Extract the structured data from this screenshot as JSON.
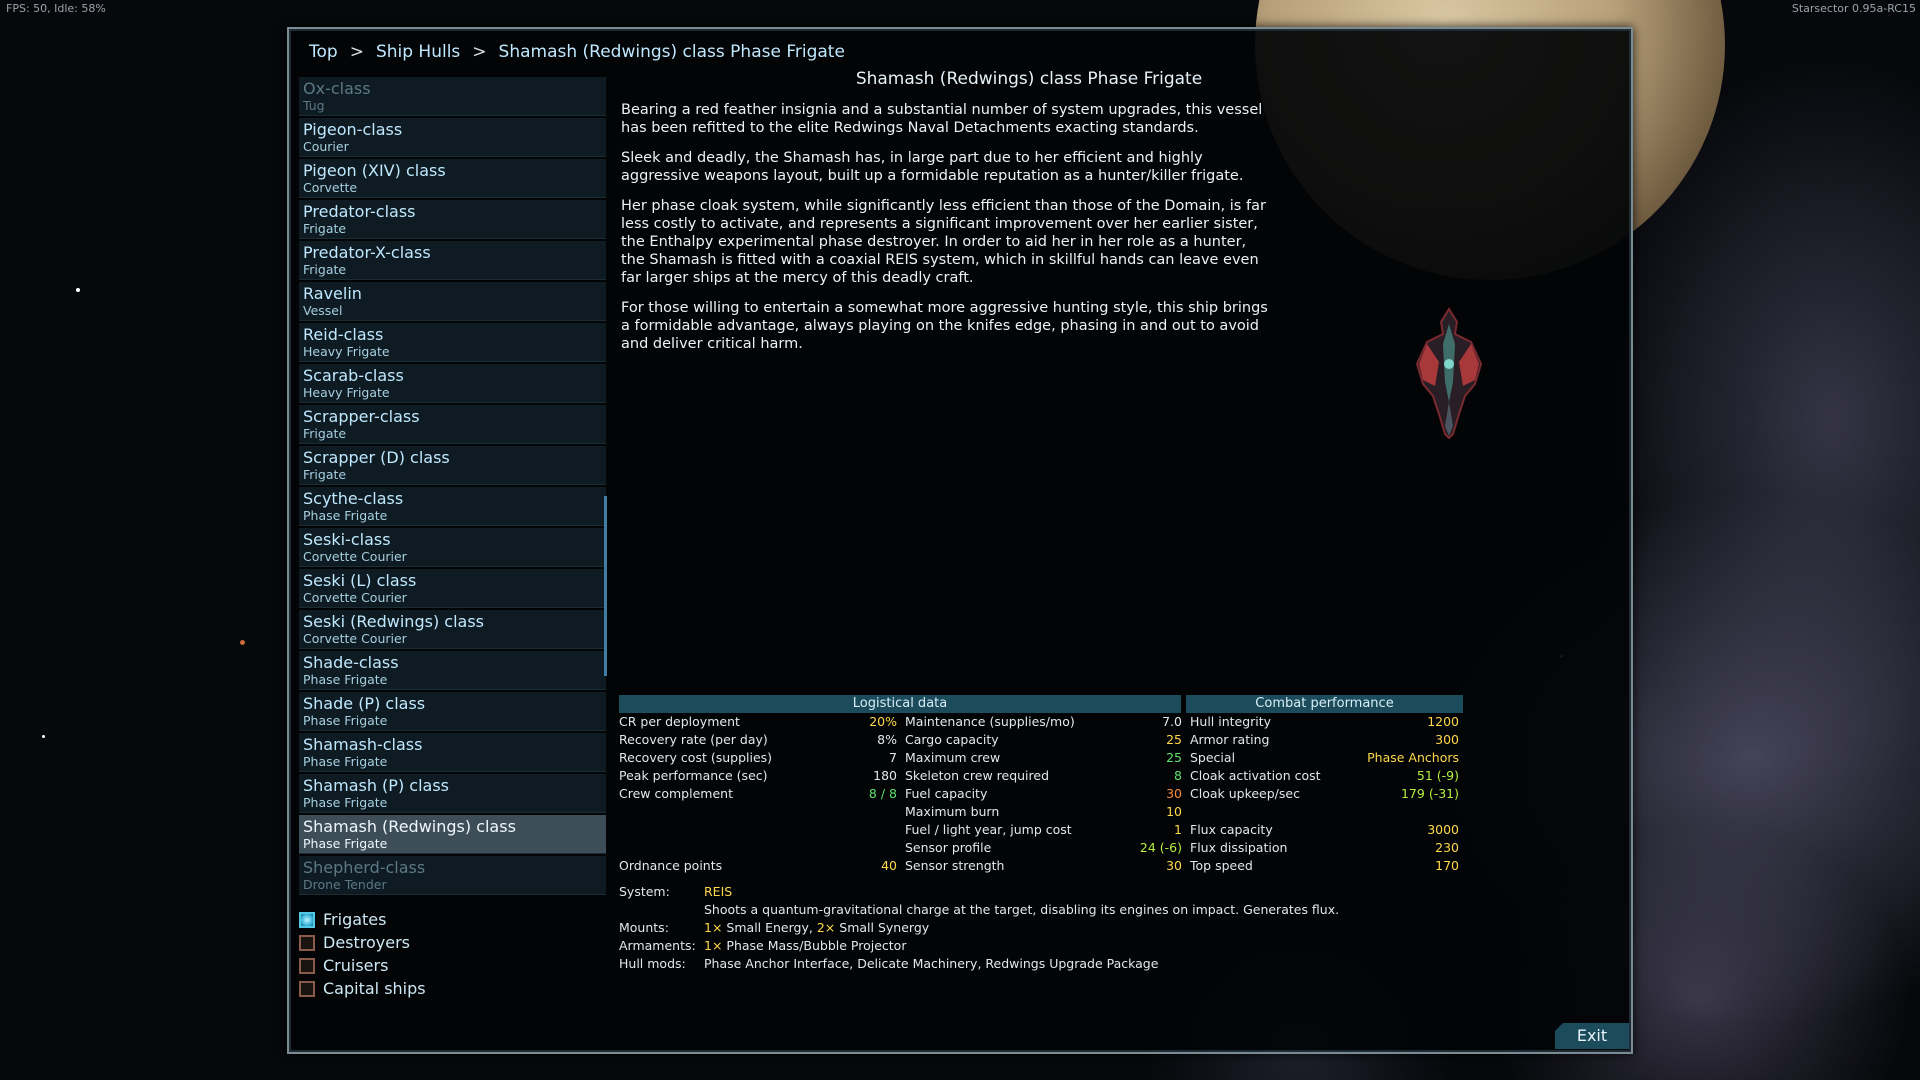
{
  "hud": {
    "fps": "FPS: 50, Idle: 58%",
    "version": "Starsector 0.95a-RC15"
  },
  "breadcrumb": {
    "root": "Top",
    "sep1": ">",
    "section": "Ship Hulls",
    "sep2": ">",
    "current": "Shamash (Redwings) class Phase Frigate"
  },
  "ships": [
    {
      "name": "Ox-class",
      "role": "Tug"
    },
    {
      "name": "Pigeon-class",
      "role": "Courier"
    },
    {
      "name": "Pigeon (XIV) class",
      "role": "Corvette"
    },
    {
      "name": "Predator-class",
      "role": "Frigate"
    },
    {
      "name": "Predator-X-class",
      "role": "Frigate"
    },
    {
      "name": "Ravelin",
      "role": "Vessel"
    },
    {
      "name": "Reid-class",
      "role": "Heavy Frigate"
    },
    {
      "name": "Scarab-class",
      "role": "Heavy Frigate"
    },
    {
      "name": "Scrapper-class",
      "role": "Frigate"
    },
    {
      "name": "Scrapper (D) class",
      "role": "Frigate"
    },
    {
      "name": "Scythe-class",
      "role": "Phase Frigate"
    },
    {
      "name": "Seski-class",
      "role": "Corvette Courier"
    },
    {
      "name": "Seski (L) class",
      "role": "Corvette Courier"
    },
    {
      "name": "Seski (Redwings) class",
      "role": "Corvette Courier"
    },
    {
      "name": "Shade-class",
      "role": "Phase Frigate"
    },
    {
      "name": "Shade (P) class",
      "role": "Phase Frigate"
    },
    {
      "name": "Shamash-class",
      "role": "Phase Frigate"
    },
    {
      "name": "Shamash (P) class",
      "role": "Phase Frigate"
    },
    {
      "name": "Shamash (Redwings) class",
      "role": "Phase Frigate"
    },
    {
      "name": "Shepherd-class",
      "role": "Drone Tender"
    }
  ],
  "filters": [
    {
      "label": "Frigates",
      "checked": true
    },
    {
      "label": "Destroyers",
      "checked": false
    },
    {
      "label": "Cruisers",
      "checked": false
    },
    {
      "label": "Capital ships",
      "checked": false
    }
  ],
  "detail": {
    "title": "Shamash (Redwings) class Phase Frigate",
    "paragraphs": [
      "Bearing a red feather insignia and a substantial number of system upgrades, this vessel has been refitted to the elite Redwings Naval Detachments exacting standards.",
      "Sleek and deadly, the Shamash has, in large part due to her efficient and highly aggressive weapons layout, built up a formidable reputation as a hunter/killer frigate.",
      "Her phase cloak system, while significantly less efficient than those of the Domain, is far less costly to activate, and represents a significant improvement over her earlier sister, the Enthalpy experimental phase destroyer. In order to aid her in her role as a hunter, the Shamash is fitted with a coaxial REIS system, which in skillful hands can leave even far larger ships at the mercy of this deadly craft.",
      "For those willing to entertain a somewhat more aggressive hunting style, this ship brings a formidable advantage, always playing on the knifes edge, phasing in and out to avoid and deliver critical harm."
    ]
  },
  "stats": {
    "logistical_header": "Logistical data",
    "combat_header": "Combat performance",
    "rows": [
      [
        {
          "label": "CR per deployment",
          "value": "20%",
          "color": "#ffd84a"
        },
        {
          "label": "Maintenance (supplies/mo)",
          "value": "7.0",
          "color": "#e4e8ea"
        },
        {
          "label": "Hull integrity",
          "value": "1200",
          "color": "#ffd84a"
        }
      ],
      [
        {
          "label": " Recovery rate (per day)",
          "value": "8%",
          "color": "#e4e8ea"
        },
        {
          "label": "Cargo capacity",
          "value": "25",
          "color": "#ffd84a"
        },
        {
          "label": "Armor rating",
          "value": "300",
          "color": "#ffd84a"
        }
      ],
      [
        {
          "label": " Recovery cost (supplies)",
          "value": "7",
          "color": "#e4e8ea"
        },
        {
          "label": "Maximum crew",
          "value": "25",
          "color": "#5ee06a"
        },
        {
          "label": "Special",
          "value": "Phase Anchors",
          "color": "#ffd84a"
        }
      ],
      [
        {
          "label": "Peak performance (sec)",
          "value": "180",
          "color": "#e4e8ea"
        },
        {
          "label": "Skeleton crew required",
          "value": "8",
          "color": "#5ee06a"
        },
        {
          "label": "Cloak activation cost",
          "value": "51 (-9)",
          "color": "#b6ef3e"
        }
      ],
      [
        {
          "label": "Crew complement",
          "value": "8 / 8",
          "color": "#5ee06a"
        },
        {
          "label": "Fuel capacity",
          "value": "30",
          "color": "#ff8c33"
        },
        {
          "label": "Cloak upkeep/sec",
          "value": "179 (-31)",
          "color": "#b6ef3e"
        }
      ],
      [
        {
          "label": "",
          "value": "",
          "color": "#e4e8ea"
        },
        {
          "label": "Maximum burn",
          "value": "10",
          "color": "#ffd84a"
        },
        {
          "label": "",
          "value": "",
          "color": "#e4e8ea"
        }
      ],
      [
        {
          "label": "",
          "value": "",
          "color": "#e4e8ea"
        },
        {
          "label": "Fuel / light year, jump cost",
          "value": "1",
          "color": "#ffd84a"
        },
        {
          "label": "Flux capacity",
          "value": "3000",
          "color": "#ffd84a"
        }
      ],
      [
        {
          "label": "",
          "value": "",
          "color": "#e4e8ea"
        },
        {
          "label": "Sensor profile",
          "value": "24 (-6)",
          "color": "#b6ef3e"
        },
        {
          "label": "Flux dissipation",
          "value": "230",
          "color": "#ffd84a"
        }
      ],
      [
        {
          "label": "Ordnance points",
          "value": "40",
          "color": "#ffd84a"
        },
        {
          "label": "Sensor strength",
          "value": "30",
          "color": "#ffd84a"
        },
        {
          "label": "Top speed",
          "value": "170",
          "color": "#ffd84a"
        }
      ]
    ]
  },
  "details": {
    "system_label": "System:",
    "system_name": "REIS",
    "system_desc": "Shoots a quantum-gravitational charge at the target, disabling its engines on impact. Generates flux.",
    "mounts_label": "Mounts:",
    "mounts": [
      {
        "count": "1×",
        "name": "Small Energy,"
      },
      {
        "count": "2×",
        "name": "Small Synergy"
      }
    ],
    "armaments_label": "Armaments:",
    "armaments_count": "1×",
    "armaments_name": "Phase Mass/Bubble Projector",
    "hullmods_label": "Hull mods:",
    "hullmods": "Phase Anchor Interface, Delicate Machinery, Redwings Upgrade Package"
  },
  "exit_label": "Exit",
  "colors": {
    "accent": "#1c4b5c",
    "highlight": "#ffd84a",
    "good": "#5ee06a",
    "warn": "#ff8c33",
    "frame": "#7c8b93"
  },
  "icons": {
    "ship": "ship-sprite",
    "checkbox": "checkbox-icon"
  }
}
